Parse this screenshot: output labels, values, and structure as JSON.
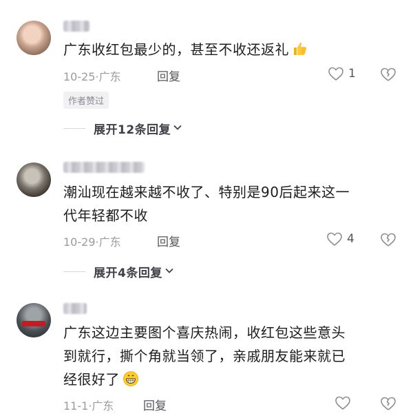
{
  "comments": [
    {
      "text": "广东收红包最少的，甚至不收还返礼",
      "date": "10-25",
      "location": "广东",
      "reply_label": "回复",
      "likes": "1",
      "badge": "作者赞过",
      "expand_label": "展开12条回复",
      "emoji": "thumbs-up-emoji"
    },
    {
      "text_line1": "潮汕现在越来越不收了、特别是90后起来这一",
      "text_line2": "代年轻都不收",
      "date": "10-29",
      "location": "广东",
      "reply_label": "回复",
      "likes": "4",
      "expand_label": "展开4条回复"
    },
    {
      "text_line1": "广东这边主要图个喜庆热闹，收红包这些意头",
      "text_line2": "到就行，撕个角就当领了，亲戚朋友能来就已",
      "text_line3": "经很好了",
      "date": "11-1",
      "location": "广东",
      "reply_label": "回复",
      "likes": "",
      "emoji": "grinning-face-emoji"
    }
  ],
  "colors": {
    "text": "#1c1c1c",
    "meta": "#9a9aa0",
    "badge_bg": "#f1f1f3"
  }
}
